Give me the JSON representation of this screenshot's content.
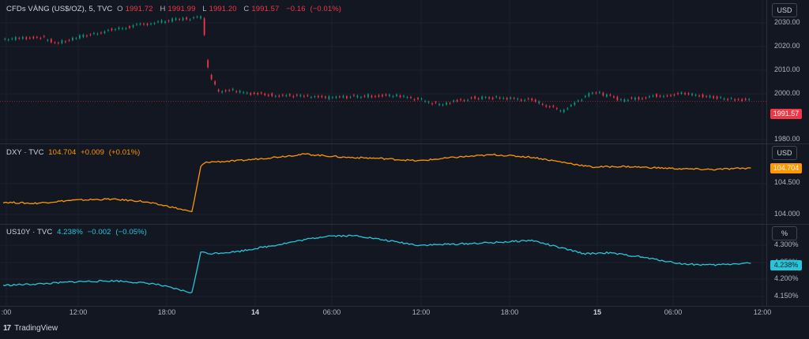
{
  "colors": {
    "bg": "#131722",
    "grid": "#1e222d",
    "up": "#089981",
    "down": "#f23645",
    "dxy": "#ff9800",
    "us10y": "#26c6da"
  },
  "panes": [
    {
      "name": "gold",
      "legend": {
        "title": "CFDs VÀNG (US$/OZ), 5, TVC",
        "o_label": "O",
        "o": "1991.72",
        "h_label": "H",
        "h": "1991.99",
        "l_label": "L",
        "l": "1991.20",
        "c_label": "C",
        "c": "1991.57",
        "change": "−0.16",
        "change_pct": "(−0.01%)"
      },
      "unit": "USD",
      "ticks": [
        "2030.00",
        "2020.00",
        "2010.00",
        "2000.00",
        "1980.00"
      ],
      "last": "1991.57"
    },
    {
      "name": "dxy",
      "legend": {
        "title": "DXY · TVC",
        "value": "104.704",
        "change": "+0.009",
        "change_pct": "(+0.01%)"
      },
      "unit": "USD",
      "ticks": [
        "104.500",
        "104.000"
      ],
      "last": "104.704"
    },
    {
      "name": "us10y",
      "legend": {
        "title": "US10Y · TVC",
        "value": "4.238%",
        "change": "−0.002",
        "change_pct": "(−0.05%)"
      },
      "unit": "%",
      "ticks": [
        "4.300%",
        "4.250%",
        "4.200%",
        "4.150%"
      ],
      "last": "4.238%"
    }
  ],
  "xaxis": {
    "ticks": [
      ":00",
      "12:00",
      "18:00",
      "14",
      "06:00",
      "12:00",
      "18:00",
      "15",
      "06:00",
      "12:00"
    ]
  },
  "branding": "TradingView",
  "chart_data": [
    {
      "type": "line",
      "title": "CFDs VÀNG (US$/OZ), 5, TVC",
      "ylim": [
        1975,
        2035
      ],
      "x": [
        0,
        0.05,
        0.07,
        0.1,
        0.14,
        0.19,
        0.23,
        0.265,
        0.268,
        0.275,
        0.285,
        0.3,
        0.33,
        0.38,
        0.43,
        0.48,
        0.53,
        0.58,
        0.62,
        0.66,
        0.7,
        0.74,
        0.78,
        0.82,
        0.86,
        0.9,
        0.95,
        0.99
      ],
      "values": [
        2020,
        2021,
        2018,
        2021,
        2024,
        2027,
        2029,
        2030,
        2012,
        2002,
        1996,
        1997,
        1995,
        1994,
        1993,
        1994,
        1994,
        1990,
        1993,
        1993,
        1992,
        1987,
        1996,
        1992,
        1994,
        1995,
        1993,
        1992
      ]
    },
    {
      "type": "line",
      "title": "DXY · TVC",
      "ylim": [
        103.9,
        105.0
      ],
      "x": [
        0,
        0.04,
        0.09,
        0.14,
        0.18,
        0.22,
        0.25,
        0.262,
        0.27,
        0.31,
        0.36,
        0.4,
        0.45,
        0.5,
        0.55,
        0.6,
        0.65,
        0.7,
        0.74,
        0.78,
        0.82,
        0.86,
        0.9,
        0.94,
        0.99
      ],
      "values": [
        104.15,
        104.13,
        104.18,
        104.2,
        104.17,
        104.08,
        103.99,
        104.75,
        104.8,
        104.82,
        104.88,
        104.93,
        104.88,
        104.86,
        104.82,
        104.88,
        104.92,
        104.88,
        104.8,
        104.72,
        104.73,
        104.71,
        104.69,
        104.68,
        104.704
      ]
    },
    {
      "type": "line",
      "title": "US10Y · TVC",
      "ylim": [
        4.14,
        4.325
      ],
      "x": [
        0,
        0.05,
        0.1,
        0.15,
        0.2,
        0.25,
        0.262,
        0.27,
        0.31,
        0.36,
        0.4,
        0.43,
        0.47,
        0.5,
        0.55,
        0.6,
        0.65,
        0.7,
        0.73,
        0.77,
        0.8,
        0.84,
        0.87,
        0.9,
        0.94,
        0.99
      ],
      "values": [
        4.178,
        4.182,
        4.188,
        4.19,
        4.182,
        4.158,
        4.27,
        4.262,
        4.268,
        4.285,
        4.3,
        4.31,
        4.31,
        4.3,
        4.285,
        4.288,
        4.292,
        4.298,
        4.282,
        4.262,
        4.265,
        4.255,
        4.245,
        4.235,
        4.232,
        4.238
      ]
    }
  ]
}
